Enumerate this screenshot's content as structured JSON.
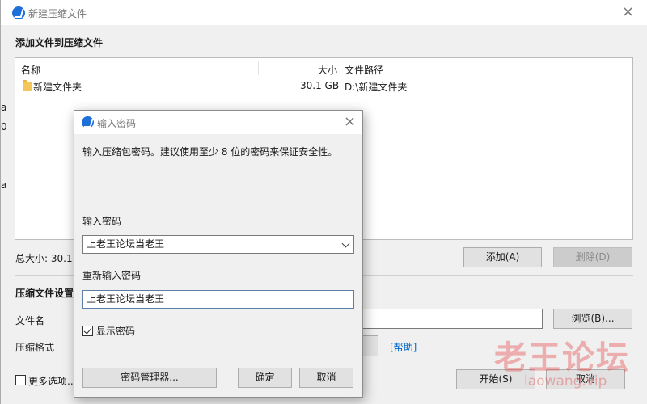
{
  "main_window": {
    "title": "新建压缩文件",
    "close_glyph": "×",
    "add_files_heading": "添加文件到压缩文件",
    "columns": {
      "name": "名称",
      "size": "大小",
      "path": "文件路径"
    },
    "rows": [
      {
        "name": "新建文件夹",
        "size": "30.1 GB",
        "path": "D:\\新建文件夹"
      }
    ],
    "total_size": "总大小: 30.1 G",
    "add_button": "添加(A)",
    "delete_button": "删除(D)",
    "settings_heading": "压缩文件设置",
    "filename_label": "文件名",
    "browse_button": "浏览(B)...",
    "format_label": "压缩格式",
    "help_link": "[帮助]",
    "more_options_label": "更多选项...",
    "start_button": "开始(S)",
    "cancel_button": "取消",
    "left_edge_glyphs": [
      "a",
      "0",
      "a"
    ]
  },
  "password_dialog": {
    "title": "输入密码",
    "close_glyph": "×",
    "description": "输入压缩包密码。建议使用至少 8 位的密码来保证安全性。",
    "password_label": "输入密码",
    "password_value": "上老王论坛当老王",
    "confirm_label": "重新输入密码",
    "confirm_value": "上老王论坛当老王",
    "show_password_label": "显示密码",
    "show_password_checked": true,
    "manager_button": "密码管理器...",
    "ok_button": "确定",
    "cancel_button": "取消"
  },
  "watermark": {
    "chinese": "老王论坛",
    "english": "laowang.vip"
  },
  "colors": {
    "accent": "#0078d7",
    "logo": "#1e6fd9",
    "link": "#0066cc",
    "watermark": "#e45050"
  }
}
